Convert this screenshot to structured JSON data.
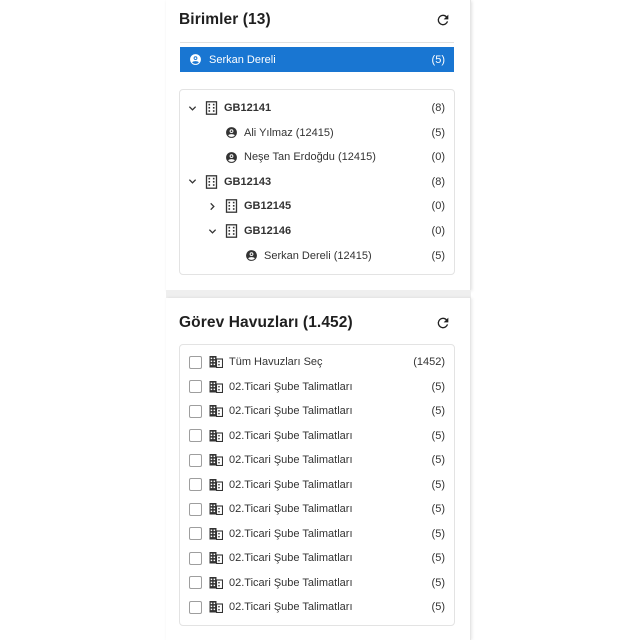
{
  "units_panel": {
    "title": "Birimler (13)",
    "selected": {
      "name": "Serkan Dereli",
      "count": "(5)"
    },
    "tree": [
      {
        "type": "group",
        "label": "GB12141",
        "count": "(8)",
        "expanded": true,
        "level": 0
      },
      {
        "type": "person",
        "label": "Ali Yılmaz (12415)",
        "count": "(5)",
        "level": 1
      },
      {
        "type": "person",
        "label": "Neşe Tan Erdoğdu (12415)",
        "count": "(0)",
        "level": 1
      },
      {
        "type": "group",
        "label": "GB12143",
        "count": "(8)",
        "expanded": true,
        "level": 0
      },
      {
        "type": "group",
        "label": "GB12145",
        "count": "(0)",
        "expanded": false,
        "level": 1
      },
      {
        "type": "group",
        "label": "GB12146",
        "count": "(0)",
        "expanded": true,
        "level": 1
      },
      {
        "type": "person",
        "label": "Serkan Dereli (12415)",
        "count": "(5)",
        "level": 2
      }
    ]
  },
  "pools_panel": {
    "title": "Görev Havuzları (1.452)",
    "select_all": {
      "label": "Tüm Havuzları Seç",
      "count": "(1452)"
    },
    "items": [
      {
        "label": "02.Ticari Şube Talimatları",
        "count": "(5)"
      },
      {
        "label": "02.Ticari Şube Talimatları",
        "count": "(5)"
      },
      {
        "label": "02.Ticari Şube Talimatları",
        "count": "(5)"
      },
      {
        "label": "02.Ticari Şube Talimatları",
        "count": "(5)"
      },
      {
        "label": "02.Ticari Şube Talimatları",
        "count": "(5)"
      },
      {
        "label": "02.Ticari Şube Talimatları",
        "count": "(5)"
      },
      {
        "label": "02.Ticari Şube Talimatları",
        "count": "(5)"
      },
      {
        "label": "02.Ticari Şube Talimatları",
        "count": "(5)"
      },
      {
        "label": "02.Ticari Şube Talimatları",
        "count": "(5)"
      },
      {
        "label": "02.Ticari Şube Talimatları",
        "count": "(5)"
      }
    ]
  },
  "colors": {
    "accent": "#1976d2",
    "text": "#212121",
    "border": "#e3e3e3"
  },
  "icons": {
    "refresh": "refresh-icon",
    "person": "account-circle-icon",
    "building": "building-icon",
    "pool": "domain-icon"
  }
}
